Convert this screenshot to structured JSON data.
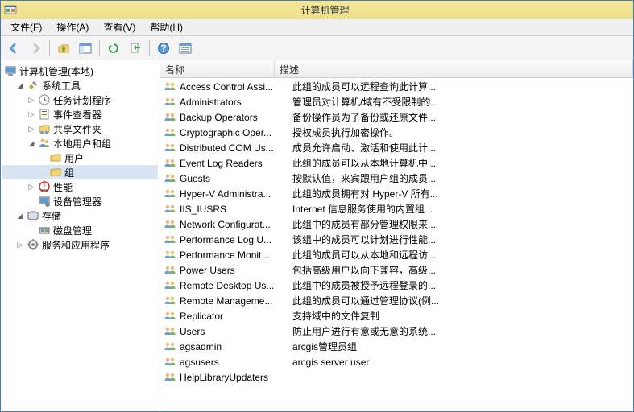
{
  "window": {
    "title": "计算机管理"
  },
  "menus": {
    "file": "文件(F)",
    "action": "操作(A)",
    "view": "查看(V)",
    "help": "帮助(H)"
  },
  "toolbar_icons": {
    "back": "back-arrow",
    "forward": "forward-arrow",
    "up": "up-folder",
    "panel": "panel-view",
    "refresh": "refresh",
    "export": "export",
    "help": "help",
    "list": "list-view"
  },
  "tree": {
    "root": "计算机管理(本地)",
    "systools": "系统工具",
    "scheduler": "任务计划程序",
    "eventviewer": "事件查看器",
    "sharedfolders": "共享文件夹",
    "localusers": "本地用户和组",
    "users": "用户",
    "groups": "组",
    "performance": "性能",
    "devmgr": "设备管理器",
    "storage": "存储",
    "diskmgmt": "磁盘管理",
    "services": "服务和应用程序"
  },
  "list_headers": {
    "name": "名称",
    "desc": "描述"
  },
  "groups": [
    {
      "name": "Access Control Assi...",
      "desc": "此组的成员可以远程查询此计算..."
    },
    {
      "name": "Administrators",
      "desc": "管理员对计算机/域有不受限制的..."
    },
    {
      "name": "Backup Operators",
      "desc": "备份操作员为了备份或还原文件..."
    },
    {
      "name": "Cryptographic Oper...",
      "desc": "授权成员执行加密操作。"
    },
    {
      "name": "Distributed COM Us...",
      "desc": "成员允许启动、激活和使用此计..."
    },
    {
      "name": "Event Log Readers",
      "desc": "此组的成员可以从本地计算机中..."
    },
    {
      "name": "Guests",
      "desc": "按默认值，来宾跟用户组的成员..."
    },
    {
      "name": "Hyper-V Administra...",
      "desc": "此组的成员拥有对 Hyper-V 所有..."
    },
    {
      "name": "IIS_IUSRS",
      "desc": "Internet 信息服务使用的内置组..."
    },
    {
      "name": "Network Configurat...",
      "desc": "此组中的成员有部分管理权限来..."
    },
    {
      "name": "Performance Log U...",
      "desc": "该组中的成员可以计划进行性能..."
    },
    {
      "name": "Performance Monit...",
      "desc": "此组的成员可以从本地和远程访..."
    },
    {
      "name": "Power Users",
      "desc": "包括高级用户以向下兼容，高级..."
    },
    {
      "name": "Remote Desktop Us...",
      "desc": "此组中的成员被授予远程登录的..."
    },
    {
      "name": "Remote Manageme...",
      "desc": "此组的成员可以通过管理协议(例..."
    },
    {
      "name": "Replicator",
      "desc": "支持域中的文件复制"
    },
    {
      "name": "Users",
      "desc": "防止用户进行有意或无意的系统..."
    },
    {
      "name": "agsadmin",
      "desc": "arcgis管理员组"
    },
    {
      "name": "agsusers",
      "desc": "arcgis server user"
    },
    {
      "name": "HelpLibraryUpdaters",
      "desc": ""
    }
  ]
}
